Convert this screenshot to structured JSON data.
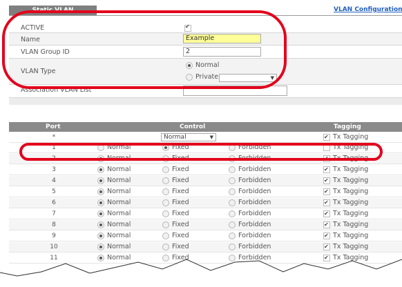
{
  "tab": "Static VLAN",
  "link": "VLAN Configuration",
  "form": {
    "active_label": "ACTIVE",
    "name_label": "Name",
    "name_value": "Example",
    "group_label": "VLAN Group ID",
    "group_value": "2",
    "type_label": "VLAN Type",
    "type_normal": "Normal",
    "type_private": "Private",
    "assoc_label": "Association VLAN List"
  },
  "table": {
    "col_port": "Port",
    "col_control": "Control",
    "col_tagging": "Tagging",
    "all_row": {
      "port": "*",
      "control": "Normal",
      "tagging": "Tx Tagging"
    },
    "opt_normal": "Normal",
    "opt_fixed": "Fixed",
    "opt_forbidden": "Forbidden",
    "tx_label": "Tx Tagging",
    "rows": [
      {
        "port": "1",
        "control": "fixed",
        "tx": false
      },
      {
        "port": "2",
        "control": "normal",
        "tx": true
      },
      {
        "port": "3",
        "control": "normal",
        "tx": true
      },
      {
        "port": "4",
        "control": "normal",
        "tx": true
      },
      {
        "port": "5",
        "control": "normal",
        "tx": true
      },
      {
        "port": "6",
        "control": "normal",
        "tx": true
      },
      {
        "port": "7",
        "control": "normal",
        "tx": true
      },
      {
        "port": "8",
        "control": "normal",
        "tx": true
      },
      {
        "port": "9",
        "control": "normal",
        "tx": true
      },
      {
        "port": "10",
        "control": "normal",
        "tx": true
      },
      {
        "port": "11",
        "control": "normal",
        "tx": true
      }
    ]
  },
  "colors": {
    "highlight": "#e3001b",
    "link": "#1f5fbf",
    "header": "#8a8a8a"
  }
}
